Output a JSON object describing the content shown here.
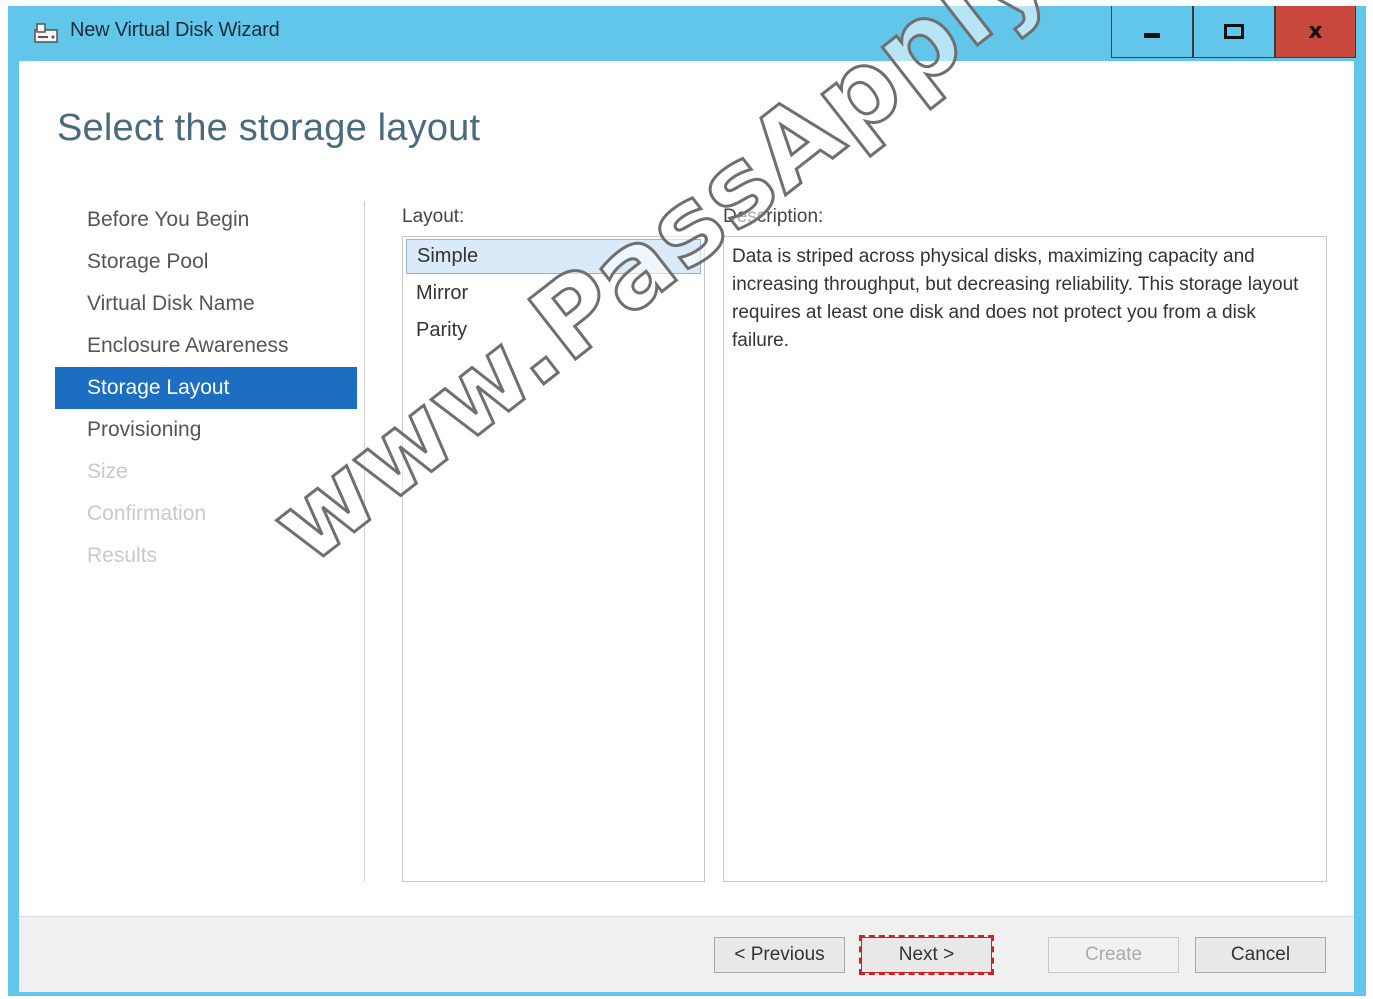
{
  "window": {
    "title": "New Virtual Disk Wizard",
    "controls": {
      "minimize_icon": "minimize-icon",
      "maximize_icon": "maximize-icon",
      "close_label": "x"
    }
  },
  "page": {
    "title": "Select the storage layout"
  },
  "nav": {
    "items": [
      {
        "label": "Before You Begin",
        "state": "normal"
      },
      {
        "label": "Storage Pool",
        "state": "normal"
      },
      {
        "label": "Virtual Disk Name",
        "state": "normal"
      },
      {
        "label": "Enclosure Awareness",
        "state": "normal"
      },
      {
        "label": "Storage Layout",
        "state": "active"
      },
      {
        "label": "Provisioning",
        "state": "normal"
      },
      {
        "label": "Size",
        "state": "disabled"
      },
      {
        "label": "Confirmation",
        "state": "disabled"
      },
      {
        "label": "Results",
        "state": "disabled"
      }
    ]
  },
  "layout": {
    "label": "Layout:",
    "options": [
      "Simple",
      "Mirror",
      "Parity"
    ],
    "selected": "Simple"
  },
  "description": {
    "label": "Description:",
    "text": "Data is striped across physical disks, maximizing capacity and increasing throughput, but decreasing reliability. This storage layout requires at least one disk and does not protect you from a disk failure."
  },
  "buttons": {
    "previous": "< Previous",
    "next": "Next >",
    "create": "Create",
    "cancel": "Cancel"
  },
  "watermark": "www.PassApply.com",
  "colors": {
    "titlebar": "#62c6ea",
    "close_button": "#c9483e",
    "nav_active": "#1b6ec2",
    "selection": "#dbeaf8",
    "highlight_outline": "#d21f1f"
  }
}
